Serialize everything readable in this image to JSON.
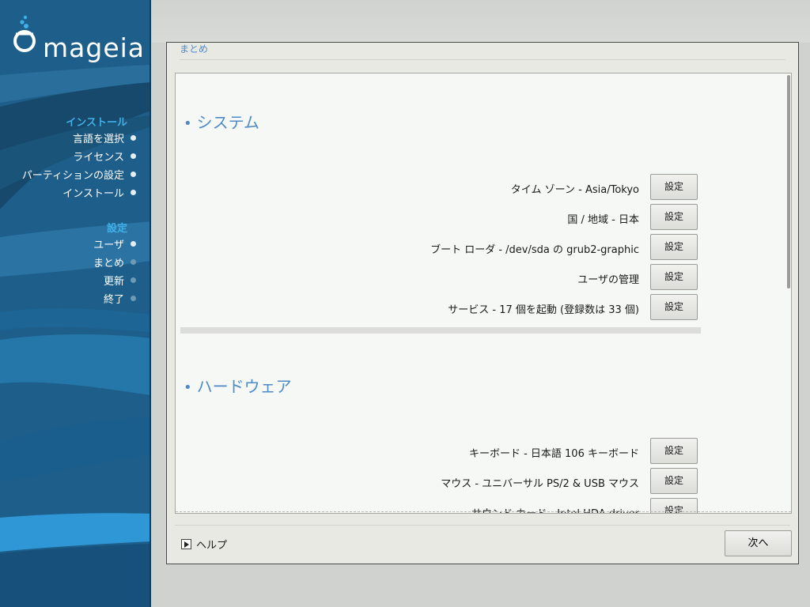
{
  "brand": {
    "name": "mageia",
    "logo_icon": "mageia-cauldron-icon"
  },
  "sidebar": {
    "groups": [
      {
        "title": "インストール",
        "items": [
          {
            "label": "言語を選択",
            "state": "done"
          },
          {
            "label": "ライセンス",
            "state": "done"
          },
          {
            "label": "パーティションの設定",
            "state": "done"
          },
          {
            "label": "インストール",
            "state": "done"
          }
        ]
      },
      {
        "title": "設定",
        "items": [
          {
            "label": "ユーザ",
            "state": "done"
          },
          {
            "label": "まとめ",
            "state": "pending"
          },
          {
            "label": "更新",
            "state": "pending"
          },
          {
            "label": "終了",
            "state": "pending"
          }
        ]
      }
    ]
  },
  "dialog": {
    "title": "まとめ",
    "sections": [
      {
        "title": "システム",
        "items": [
          {
            "label": "タイム ゾーン - Asia/Tokyo",
            "button": "設定"
          },
          {
            "label": "国 / 地域 - 日本",
            "button": "設定"
          },
          {
            "label": "ブート ローダ - /dev/sda の grub2-graphic",
            "button": "設定"
          },
          {
            "label": "ユーザの管理",
            "button": "設定"
          },
          {
            "label": "サービス - 17 個を起動 (登録数は 33 個)",
            "button": "設定"
          }
        ]
      },
      {
        "title": "ハードウェア",
        "items": [
          {
            "label": "キーボード - 日本語 106 キーボード",
            "button": "設定"
          },
          {
            "label": "マウス - ユニバーサル PS/2 & USB マウス",
            "button": "設定"
          },
          {
            "label": "サウンド カード - Intel HDA driver",
            "button": "設定"
          }
        ]
      }
    ],
    "help_label": "ヘルプ",
    "next_label": "次へ"
  },
  "colors": {
    "sidebar_bg": "#1e5e8a",
    "accent": "#4f8ac9",
    "step_header": "#3fb0e8"
  }
}
